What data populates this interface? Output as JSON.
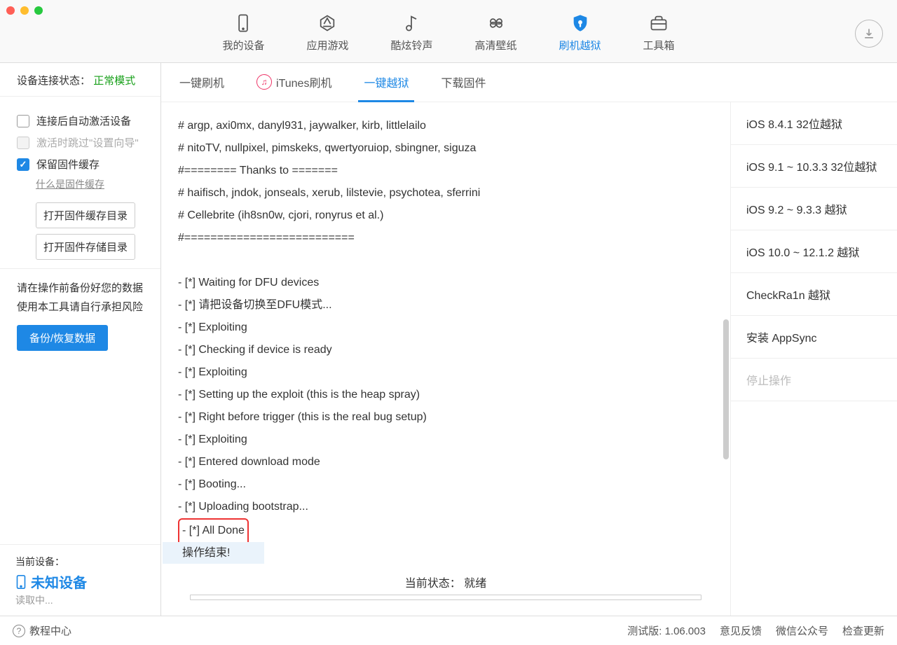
{
  "header": {
    "tabs": [
      {
        "label": "我的设备"
      },
      {
        "label": "应用游戏"
      },
      {
        "label": "酷炫铃声"
      },
      {
        "label": "高清壁纸"
      },
      {
        "label": "刷机越狱"
      },
      {
        "label": "工具箱"
      }
    ],
    "active_index": 4
  },
  "sidebar": {
    "conn_label": "设备连接状态：",
    "conn_status": "正常模式",
    "checks": {
      "auto_activate": "连接后自动激活设备",
      "skip_setup": "激活时跳过\"设置向导\"",
      "keep_cache": "保留固件缓存"
    },
    "what_is_cache": "什么是固件缓存",
    "open_cache_dir": "打开固件缓存目录",
    "open_store_dir": "打开固件存储目录",
    "warn_line1": "请在操作前备份好您的数据",
    "warn_line2": "使用本工具请自行承担风险",
    "backup_btn": "备份/恢复数据",
    "device_label": "当前设备：",
    "device_name": "未知设备",
    "device_reading": "读取中..."
  },
  "subtabs": {
    "items": [
      {
        "label": "一键刷机"
      },
      {
        "label": "iTunes刷机"
      },
      {
        "label": "一键越狱"
      },
      {
        "label": "下载固件"
      }
    ],
    "active_index": 2
  },
  "log": {
    "lines": [
      "# argp, axi0mx, danyl931, jaywalker, kirb, littlelailo",
      "# nitoTV, nullpixel, pimskeks, qwertyoruiop, sbingner, siguza",
      "#======== Thanks to =======",
      "# haifisch, jndok, jonseals, xerub, lilstevie, psychotea, sferrini",
      "# Cellebrite (ih8sn0w, cjori, ronyrus et al.)",
      "#==========================",
      "",
      "- [*] Waiting for DFU devices",
      "- [*] 请把设备切换至DFU模式...",
      "- [*] Exploiting",
      "- [*] Checking if device is ready",
      "- [*] Exploiting",
      "- [*] Setting up the exploit (this is the heap spray)",
      "- [*] Right before trigger (this is the real bug setup)",
      "- [*] Exploiting",
      "- [*] Entered download mode",
      "- [*] Booting...",
      "- [*] Uploading bootstrap..."
    ],
    "boxed_line1": "- [*] All Done",
    "boxed_line2": "操作结束!",
    "status_label": "当前状态：",
    "status_value": "就绪"
  },
  "right_panel": {
    "items": [
      {
        "label": "iOS 8.4.1 32位越狱",
        "disabled": false
      },
      {
        "label": "iOS 9.1 ~ 10.3.3 32位越狱",
        "disabled": false
      },
      {
        "label": "iOS 9.2 ~ 9.3.3 越狱",
        "disabled": false
      },
      {
        "label": "iOS 10.0 ~ 12.1.2 越狱",
        "disabled": false
      },
      {
        "label": "CheckRa1n 越狱",
        "disabled": false
      },
      {
        "label": "安装 AppSync",
        "disabled": false
      },
      {
        "label": "停止操作",
        "disabled": true
      }
    ]
  },
  "footer": {
    "help_center": "教程中心",
    "version_label": "测试版:",
    "version_value": "1.06.003",
    "feedback": "意见反馈",
    "wechat": "微信公众号",
    "check_update": "检查更新"
  }
}
